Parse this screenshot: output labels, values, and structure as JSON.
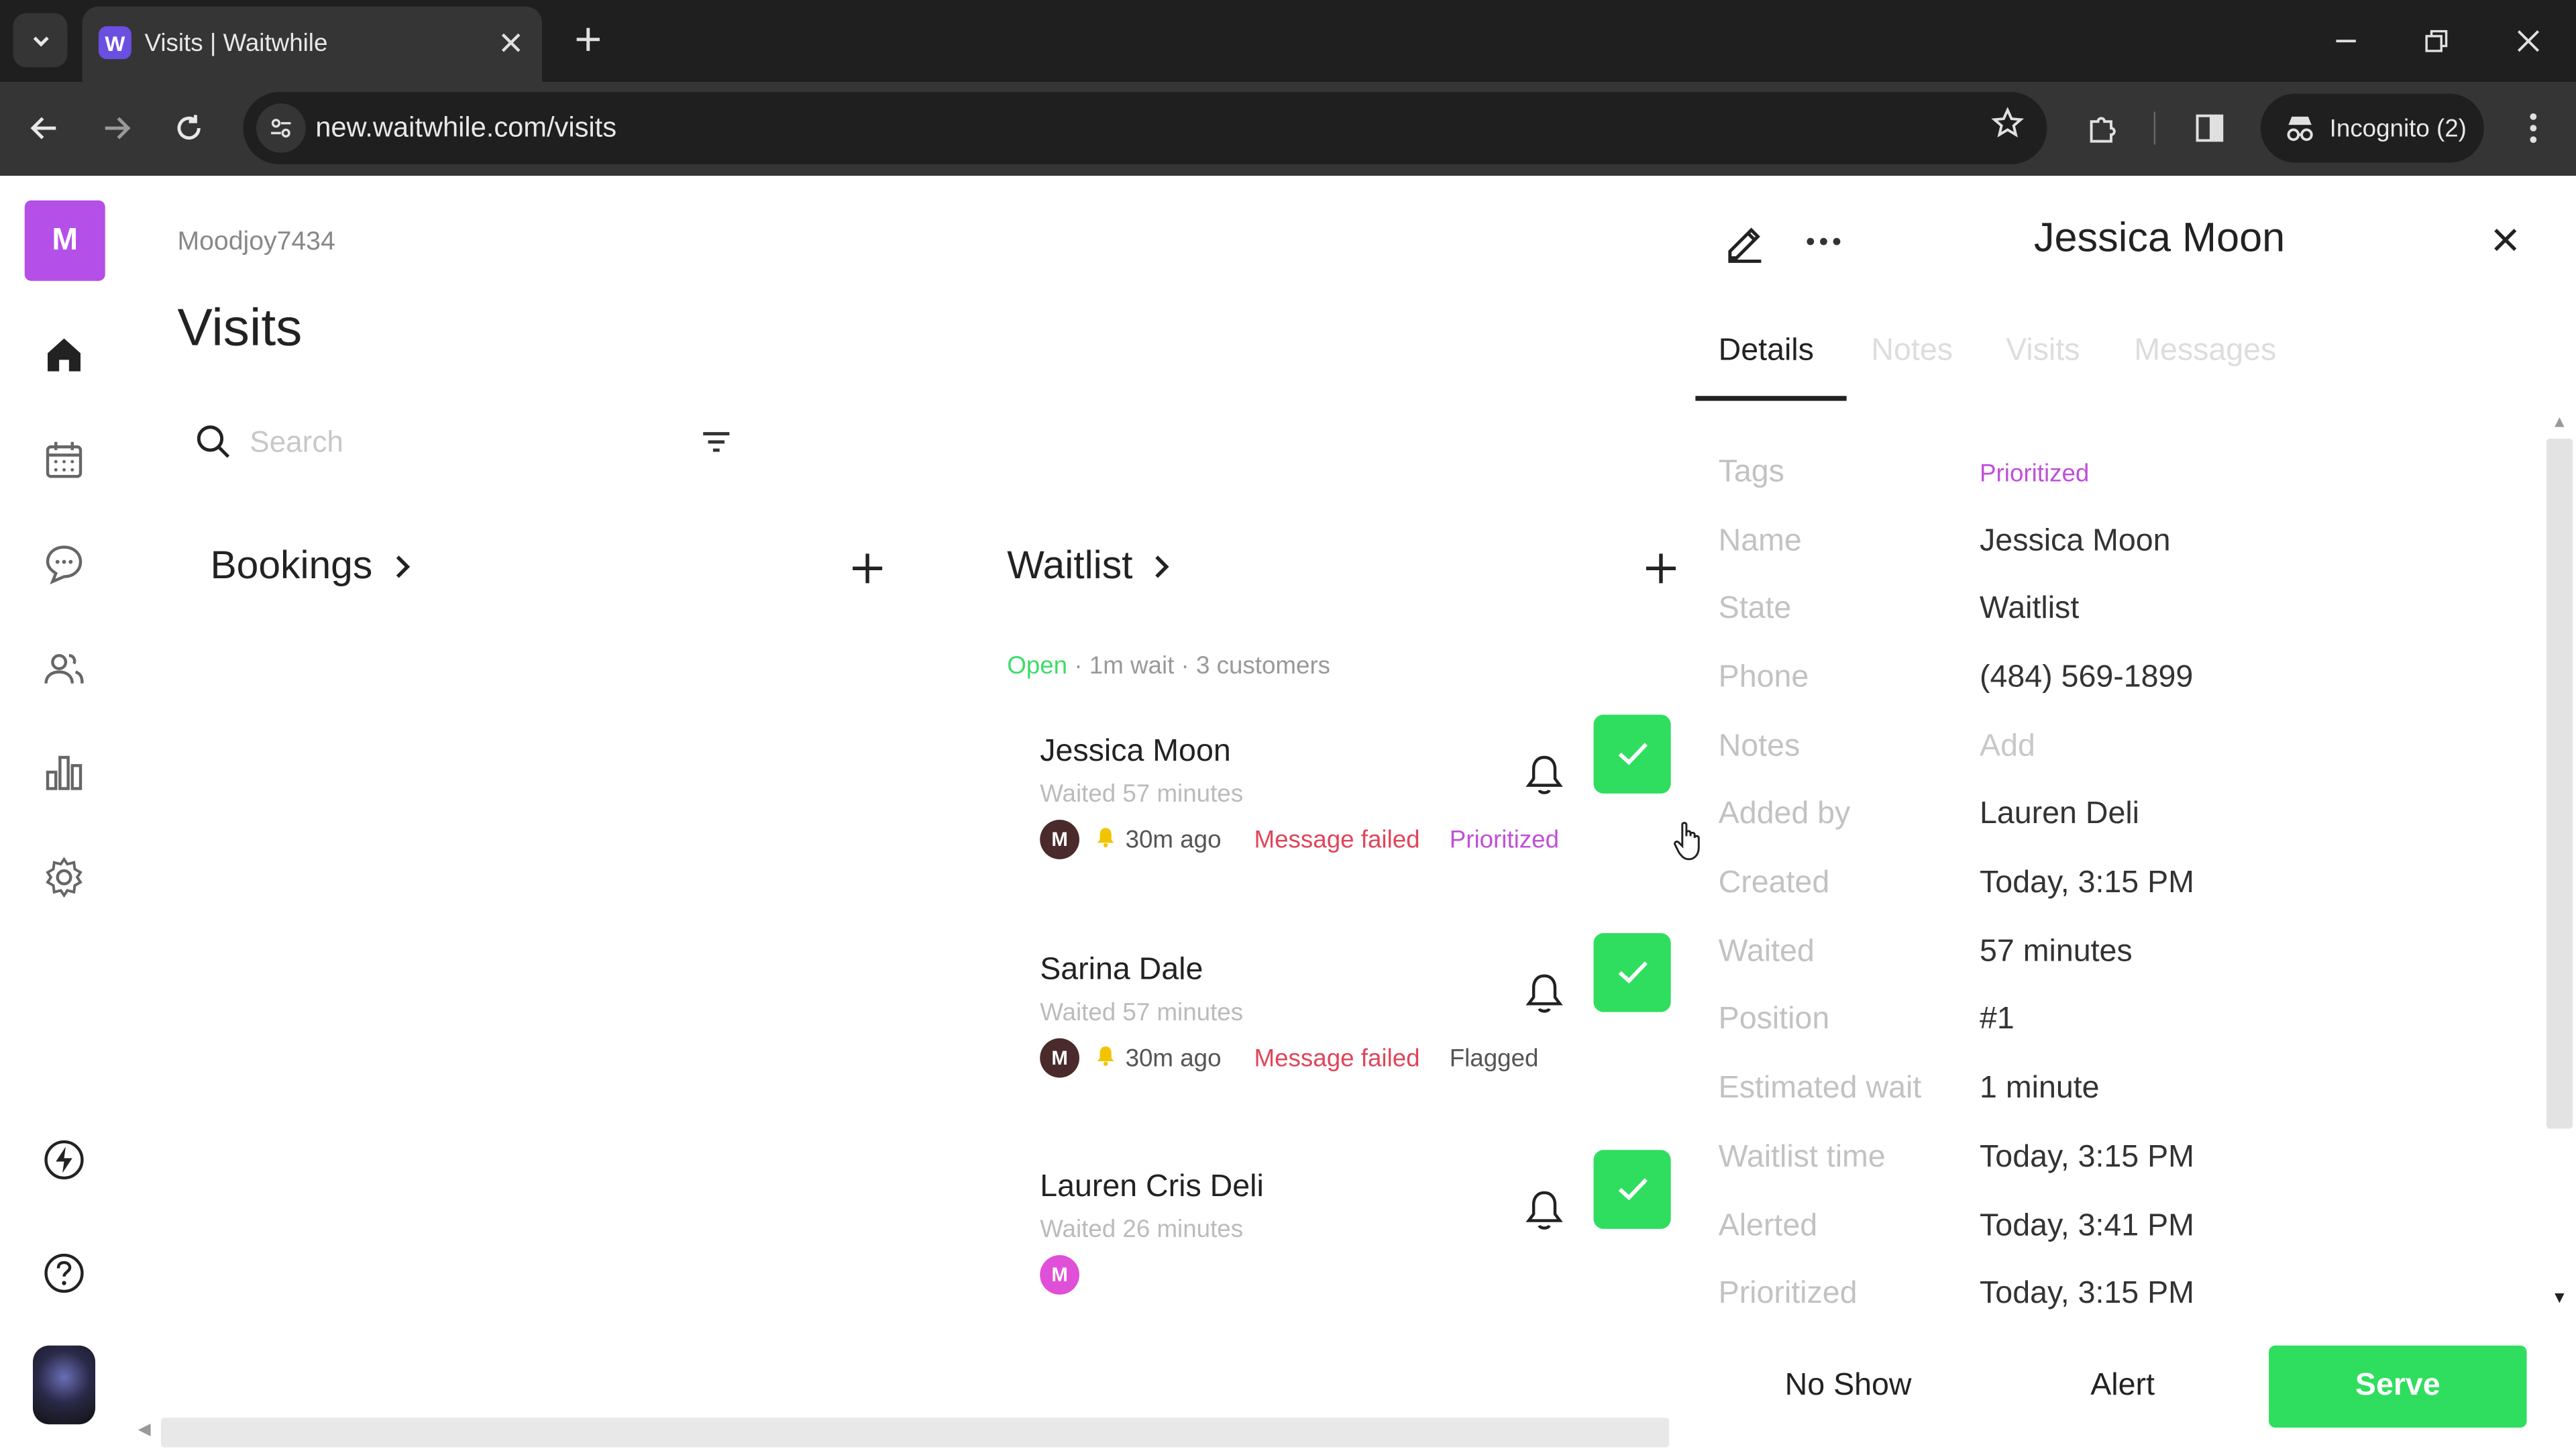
{
  "browser": {
    "tab_title": "Visits | Waitwhile",
    "tab_favicon_letter": "W",
    "url": "new.waitwhile.com/visits",
    "incognito_label": "Incognito (2)",
    "icons": {
      "tab_search": "chevron-down-icon",
      "close_tab": "close-icon",
      "new_tab": "plus-icon",
      "back": "arrow-left-icon",
      "forward": "arrow-right-icon",
      "reload": "reload-icon",
      "site_info": "tune-icon",
      "bookmark": "star-icon",
      "extensions": "puzzle-icon",
      "side_panel": "side-panel-icon",
      "incognito": "incognito-icon",
      "menu": "kebab-icon",
      "minimize": "minimize-icon",
      "restore": "restore-icon",
      "close_window": "close-icon"
    }
  },
  "sidebar": {
    "org_initial": "M",
    "items": [
      {
        "name": "home",
        "icon": "home-icon",
        "active": true
      },
      {
        "name": "calendar",
        "icon": "calendar-icon",
        "active": false
      },
      {
        "name": "messages",
        "icon": "chat-icon",
        "active": false
      },
      {
        "name": "customers",
        "icon": "users-icon",
        "active": false
      },
      {
        "name": "analytics",
        "icon": "bar-chart-icon",
        "active": false
      },
      {
        "name": "settings",
        "icon": "gear-icon",
        "active": false
      }
    ],
    "bottom_items": [
      {
        "name": "whats-new",
        "icon": "bolt-icon"
      },
      {
        "name": "help",
        "icon": "help-icon"
      }
    ]
  },
  "main": {
    "org_name": "Moodjoy7434",
    "title": "Visits",
    "search_placeholder": "Search",
    "bookings": {
      "title": "Bookings"
    },
    "waitlist": {
      "title": "Waitlist",
      "status_open": "Open",
      "status_rest": " · 1m wait · 3 customers",
      "cards": [
        {
          "name": "Jessica Moon",
          "waited": "Waited 57 minutes",
          "avatar": "M",
          "alerted": "30m ago",
          "message_status": "Message failed",
          "tag": "Prioritized"
        },
        {
          "name": "Sarina Dale",
          "waited": "Waited 57 minutes",
          "avatar": "M",
          "alerted": "30m ago",
          "message_status": "Message failed",
          "tag": "Flagged"
        },
        {
          "name": "Lauren Cris Deli",
          "waited": "Waited 26 minutes",
          "avatar": "M"
        }
      ]
    }
  },
  "panel": {
    "title": "Jessica Moon",
    "tabs": [
      "Details",
      "Notes",
      "Visits",
      "Messages"
    ],
    "active_tab": "Details",
    "rows": [
      {
        "label": "Tags",
        "value": "Prioritized"
      },
      {
        "label": "Name",
        "value": "Jessica Moon"
      },
      {
        "label": "State",
        "value": "Waitlist"
      },
      {
        "label": "Phone",
        "value": "(484) 569-1899"
      },
      {
        "label": "Notes",
        "value": "Add"
      },
      {
        "label": "Added by",
        "value": "Lauren Deli"
      },
      {
        "label": "Created",
        "value": "Today, 3:15 PM"
      },
      {
        "label": "Waited",
        "value": "57 minutes"
      },
      {
        "label": "Position",
        "value": "#1"
      },
      {
        "label": "Estimated wait",
        "value": "1 minute"
      },
      {
        "label": "Waitlist time",
        "value": "Today, 3:15 PM"
      },
      {
        "label": "Alerted",
        "value": "Today, 3:41 PM"
      },
      {
        "label": "Prioritized",
        "value": "Today, 3:15 PM"
      }
    ],
    "actions": {
      "no_show": "No Show",
      "alert": "Alert",
      "serve": "Serve"
    }
  },
  "colors": {
    "brand_purple": "#b44fe8",
    "serve_green": "#2fde5e",
    "open_green": "#3ddc6a",
    "error_red": "#e0455a",
    "tag_purple": "#c04fd8"
  }
}
